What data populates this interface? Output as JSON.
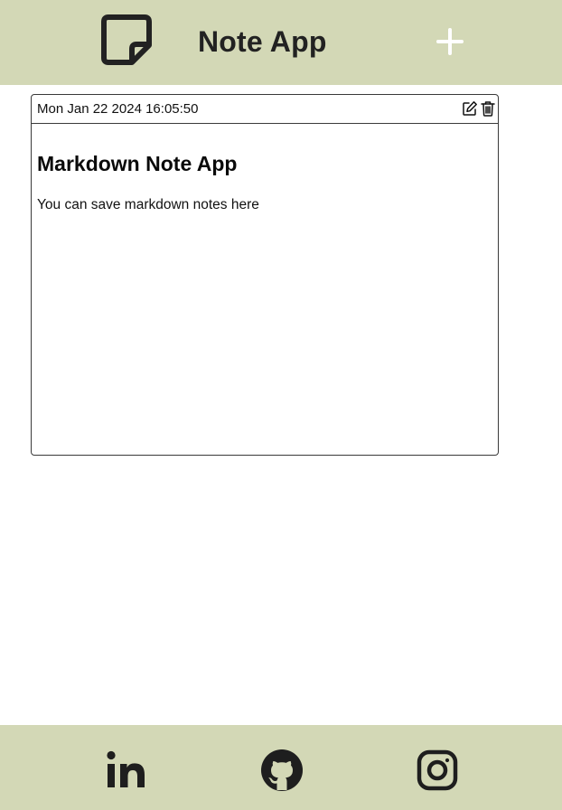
{
  "header": {
    "title": "Note App",
    "logo_icon": "sticky-note-icon",
    "add_icon": "plus-icon"
  },
  "notes": [
    {
      "date": "Mon Jan 22 2024 16:05:50",
      "heading": "Markdown Note App",
      "body": "You can save markdown notes here",
      "actions": [
        "edit-icon",
        "trash-icon"
      ]
    }
  ],
  "footer": {
    "links": [
      "linkedin-icon",
      "github-icon",
      "instagram-icon"
    ]
  },
  "colors": {
    "bar_background": "#d3d8b6",
    "text": "#222222",
    "add_icon": "#ffffff"
  }
}
